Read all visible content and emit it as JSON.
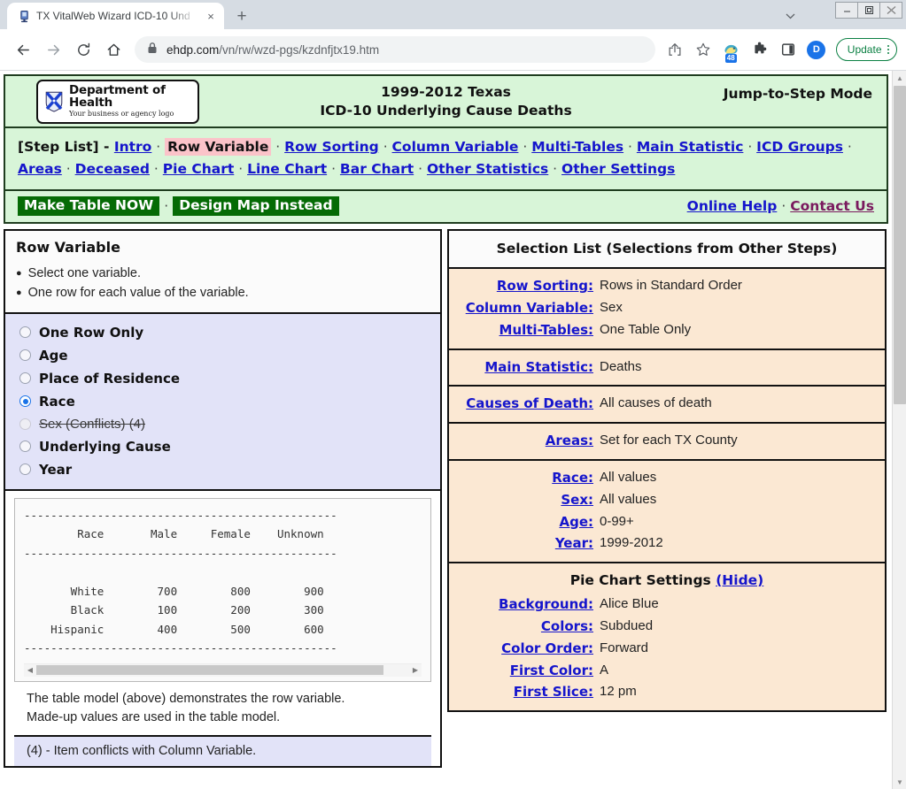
{
  "browser": {
    "tab": {
      "title": "TX VitalWeb Wizard ICD-10 Und",
      "favicon": "document-icon",
      "close": "×"
    },
    "newtab_label": "+",
    "tabstrip_chevron": "⌄",
    "window_controls": {
      "minimize": "–",
      "maximize": "▣",
      "close": "✕"
    },
    "nav": {
      "back": "←",
      "forward": "→",
      "reload": "⟳",
      "home": "⌂"
    },
    "omnibox": {
      "lock": "lock-icon",
      "host": "ehdp.com",
      "path": "/vn/rw/wzd-pgs/kzdnfjtx19.htm"
    },
    "toolbar_icons": {
      "share": "share-icon",
      "bookmark": "☆",
      "extension_badge_count": "48",
      "puzzle": "puzzle-icon",
      "side_panel": "side-panel-icon",
      "profile_initial": "D",
      "update_label": "Update"
    }
  },
  "header": {
    "logo": {
      "title": "Department of Health",
      "subtitle": "Your business or agency logo"
    },
    "title_line1": "1999-2012 Texas",
    "title_line2": "ICD-10 Underlying Cause Deaths",
    "mode": "Jump-to-Step Mode"
  },
  "steplist": {
    "prefix": "[Step List]",
    "dash": "-",
    "items": [
      {
        "label": "Intro",
        "current": false
      },
      {
        "label": "Row Variable",
        "current": true
      },
      {
        "label": "Row Sorting",
        "current": false
      },
      {
        "label": "Column Variable",
        "current": false
      },
      {
        "label": "Multi-Tables",
        "current": false
      },
      {
        "label": "Main Statistic",
        "current": false
      },
      {
        "label": "ICD Groups",
        "current": false
      },
      {
        "label": "Areas",
        "current": false
      },
      {
        "label": "Deceased",
        "current": false
      },
      {
        "label": "Pie Chart",
        "current": false
      },
      {
        "label": "Line Chart",
        "current": false
      },
      {
        "label": "Bar Chart",
        "current": false
      },
      {
        "label": "Other Statistics",
        "current": false
      },
      {
        "label": "Other Settings",
        "current": false
      }
    ],
    "separator": "·"
  },
  "actionbar": {
    "make_table": "Make Table NOW",
    "separator": "·",
    "design_map": "Design Map Instead",
    "online_help": "Online Help",
    "contact_us": "Contact Us"
  },
  "row_variable": {
    "title": "Row Variable",
    "bullets": [
      "Select one variable.",
      "One row for each value of the variable."
    ],
    "options": [
      {
        "label": "One Row Only",
        "selected": false,
        "disabled": false
      },
      {
        "label": "Age",
        "selected": false,
        "disabled": false
      },
      {
        "label": "Place of Residence",
        "selected": false,
        "disabled": false
      },
      {
        "label": "Race",
        "selected": true,
        "disabled": false
      },
      {
        "label": "Sex (Conflicts) (4)",
        "selected": false,
        "disabled": true
      },
      {
        "label": "Underlying Cause",
        "selected": false,
        "disabled": false
      },
      {
        "label": "Year",
        "selected": false,
        "disabled": false
      }
    ],
    "table_model": "-----------------------------------------------\n        Race       Male     Female    Unknown\n-----------------------------------------------\n\n       White        700        800        900\n       Black        100        200        300\n    Hispanic        400        500        600\n-----------------------------------------------",
    "model_note_line1": "The table model (above) demonstrates the row variable.",
    "model_note_line2": "Made-up values are used in the table model.",
    "footnote": "(4) - Item conflicts with Column Variable."
  },
  "selection_list": {
    "title": "Selection List (Selections from Other Steps)",
    "groups": [
      {
        "rows": [
          {
            "label": "Row Sorting:",
            "value": "Rows in Standard Order"
          },
          {
            "label": "Column Variable:",
            "value": "Sex"
          },
          {
            "label": "Multi-Tables:",
            "value": "One Table Only"
          }
        ]
      },
      {
        "rows": [
          {
            "label": "Main Statistic:",
            "value": "Deaths"
          }
        ]
      },
      {
        "rows": [
          {
            "label": "Causes of Death:",
            "value": "All causes of death"
          }
        ]
      },
      {
        "rows": [
          {
            "label": "Areas:",
            "value": "Set for each TX County"
          }
        ]
      },
      {
        "rows": [
          {
            "label": "Race:",
            "value": "All values"
          },
          {
            "label": "Sex:",
            "value": "All values"
          },
          {
            "label": "Age:",
            "value": "0-99+"
          },
          {
            "label": "Year:",
            "value": "1999-2012"
          }
        ]
      }
    ],
    "pie_settings": {
      "title": "Pie Chart Settings",
      "hide_label": "(Hide)",
      "rows": [
        {
          "label": "Background:",
          "value": "Alice Blue"
        },
        {
          "label": "Colors:",
          "value": "Subdued"
        },
        {
          "label": "Color Order:",
          "value": "Forward"
        },
        {
          "label": "First Color:",
          "value": "A"
        },
        {
          "label": "First Slice:",
          "value": "12 pm"
        }
      ]
    }
  },
  "colors": {
    "header_green_bg": "#d8f5d8",
    "header_border": "#1f3d1f",
    "link_blue": "#1515cc",
    "visited_purple": "#7a1a5e",
    "current_step_highlight": "#fbc3c9",
    "button_green": "#056b05",
    "options_lavender": "#e2e3f8",
    "selection_peach": "#fbe8d3",
    "radio_accent": "#1a73e8"
  }
}
